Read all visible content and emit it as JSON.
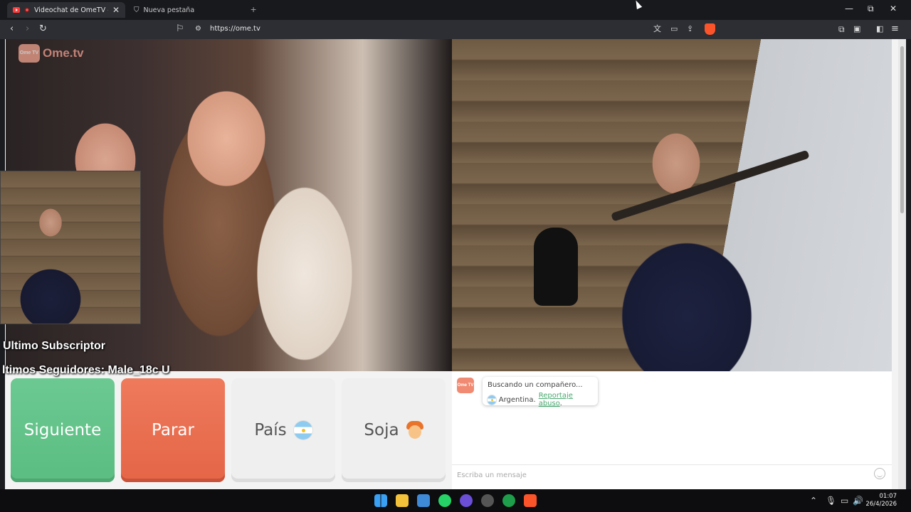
{
  "browser": {
    "tabs": [
      {
        "title": "Videochat de OmeTV — Alter"
      },
      {
        "title": "Nueva pestaña"
      }
    ],
    "new_tab_icon": "+",
    "url": "https://ome.tv",
    "window_controls": {
      "minimize": "—",
      "restore": "⧉",
      "close": "✕"
    }
  },
  "page": {
    "logo_badge": "Ome TV",
    "logo_text": "Ome.tv",
    "stream_overlay": {
      "last_subscriber": "Ultimo Subscriptor",
      "last_followers": "ltimos Seguidores: Male_18c    U"
    },
    "buttons": {
      "next": "Siguiente",
      "stop": "Parar",
      "country": "País",
      "gender": "Soja"
    },
    "chat": {
      "logo_badge": "Ome TV",
      "status": "Buscando un compañero...",
      "country": "Argentina.",
      "report_link": "Reportaje abuso",
      "report_suffix": ".",
      "input_placeholder": "Escriba un mensaje"
    }
  },
  "taskbar": {
    "time": "01:07",
    "date": "26/4/2026"
  },
  "colors": {
    "next_button": "#5bbd82",
    "stop_button": "#e56547",
    "report_link": "#4aa870",
    "brand": "#f08a72"
  }
}
